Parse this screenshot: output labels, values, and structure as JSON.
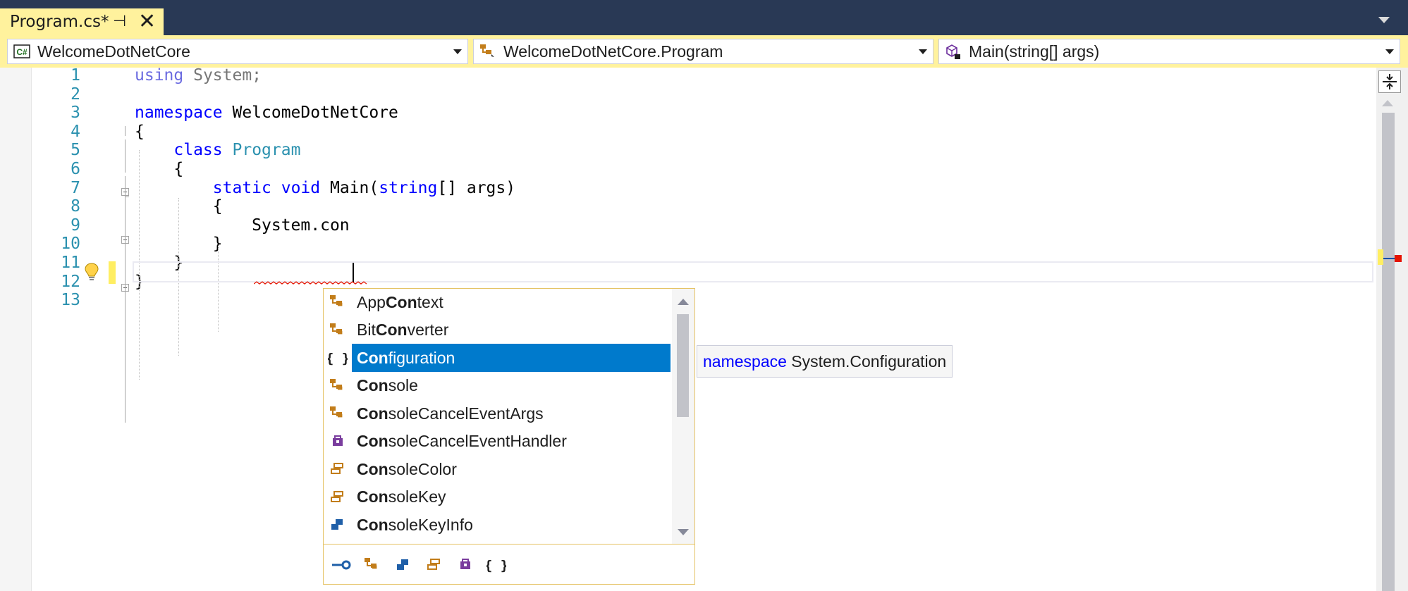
{
  "tab": {
    "title": "Program.cs*",
    "pin_glyph": "⊣",
    "close_glyph": "✕"
  },
  "navbar": {
    "project": {
      "icon": "csharp-project-icon",
      "icon_text": "C#",
      "label": "WelcomeDotNetCore"
    },
    "type": {
      "icon": "class-icon",
      "label": "WelcomeDotNetCore.Program"
    },
    "member": {
      "icon": "method-icon",
      "label": "Main(string[] args)"
    }
  },
  "editor": {
    "line_numbers": [
      "1",
      "2",
      "3",
      "4",
      "5",
      "6",
      "7",
      "8",
      "9",
      "10",
      "11",
      "12",
      "13"
    ],
    "lines": [
      {
        "tokens": [
          {
            "c": "dimkw",
            "t": "using"
          },
          {
            "c": "dim",
            "t": " System;"
          }
        ]
      },
      {
        "tokens": []
      },
      {
        "tokens": [
          {
            "c": "kw",
            "t": "namespace"
          },
          {
            "c": "",
            "t": " WelcomeDotNetCore"
          }
        ]
      },
      {
        "tokens": [
          {
            "c": "",
            "t": "{"
          }
        ]
      },
      {
        "tokens": [
          {
            "c": "",
            "t": "    "
          },
          {
            "c": "kw",
            "t": "class"
          },
          {
            "c": "",
            "t": " "
          },
          {
            "c": "type",
            "t": "Program"
          }
        ]
      },
      {
        "tokens": [
          {
            "c": "",
            "t": "    {"
          }
        ]
      },
      {
        "tokens": [
          {
            "c": "",
            "t": "        "
          },
          {
            "c": "kw",
            "t": "static"
          },
          {
            "c": "",
            "t": " "
          },
          {
            "c": "kw",
            "t": "void"
          },
          {
            "c": "",
            "t": " Main("
          },
          {
            "c": "kw",
            "t": "string"
          },
          {
            "c": "",
            "t": "[] args)"
          }
        ]
      },
      {
        "tokens": [
          {
            "c": "",
            "t": "        {"
          }
        ]
      },
      {
        "tokens": [
          {
            "c": "",
            "t": "            System.con"
          }
        ]
      },
      {
        "tokens": [
          {
            "c": "",
            "t": "        }"
          }
        ]
      },
      {
        "tokens": [
          {
            "c": "",
            "t": "    }"
          }
        ]
      },
      {
        "tokens": [
          {
            "c": "",
            "t": "}"
          }
        ]
      },
      {
        "tokens": []
      }
    ]
  },
  "completion": {
    "match_prefix": "Con",
    "items": [
      {
        "icon": "class-icon",
        "pre": "App",
        "match": "Con",
        "post": "text",
        "selected": false
      },
      {
        "icon": "class-icon",
        "pre": "Bit",
        "match": "Con",
        "post": "verter",
        "selected": false
      },
      {
        "icon": "namespace-icon",
        "pre": "",
        "match": "Con",
        "post": "figuration",
        "selected": true
      },
      {
        "icon": "class-icon",
        "pre": "",
        "match": "Con",
        "post": "sole",
        "selected": false
      },
      {
        "icon": "class-icon",
        "pre": "",
        "match": "Con",
        "post": "soleCancelEventArgs",
        "selected": false
      },
      {
        "icon": "delegate-icon",
        "pre": "",
        "match": "Con",
        "post": "soleCancelEventHandler",
        "selected": false
      },
      {
        "icon": "enum-icon",
        "pre": "",
        "match": "Con",
        "post": "soleColor",
        "selected": false
      },
      {
        "icon": "enum-icon",
        "pre": "",
        "match": "Con",
        "post": "soleKey",
        "selected": false
      },
      {
        "icon": "struct-icon",
        "pre": "",
        "match": "Con",
        "post": "soleKeyInfo",
        "selected": false
      }
    ],
    "filters": [
      "interface-filter-icon",
      "class-filter-icon",
      "struct-filter-icon",
      "enum-filter-icon",
      "delegate-filter-icon",
      "namespace-filter-icon"
    ]
  },
  "tooltip": {
    "keyword": "namespace",
    "name": " System.Configuration"
  },
  "colors": {
    "accent": "#007ACC",
    "tab_active": "#FFF29D",
    "frame": "#293955",
    "keyword": "#0000FF",
    "type": "#2B91AF"
  }
}
